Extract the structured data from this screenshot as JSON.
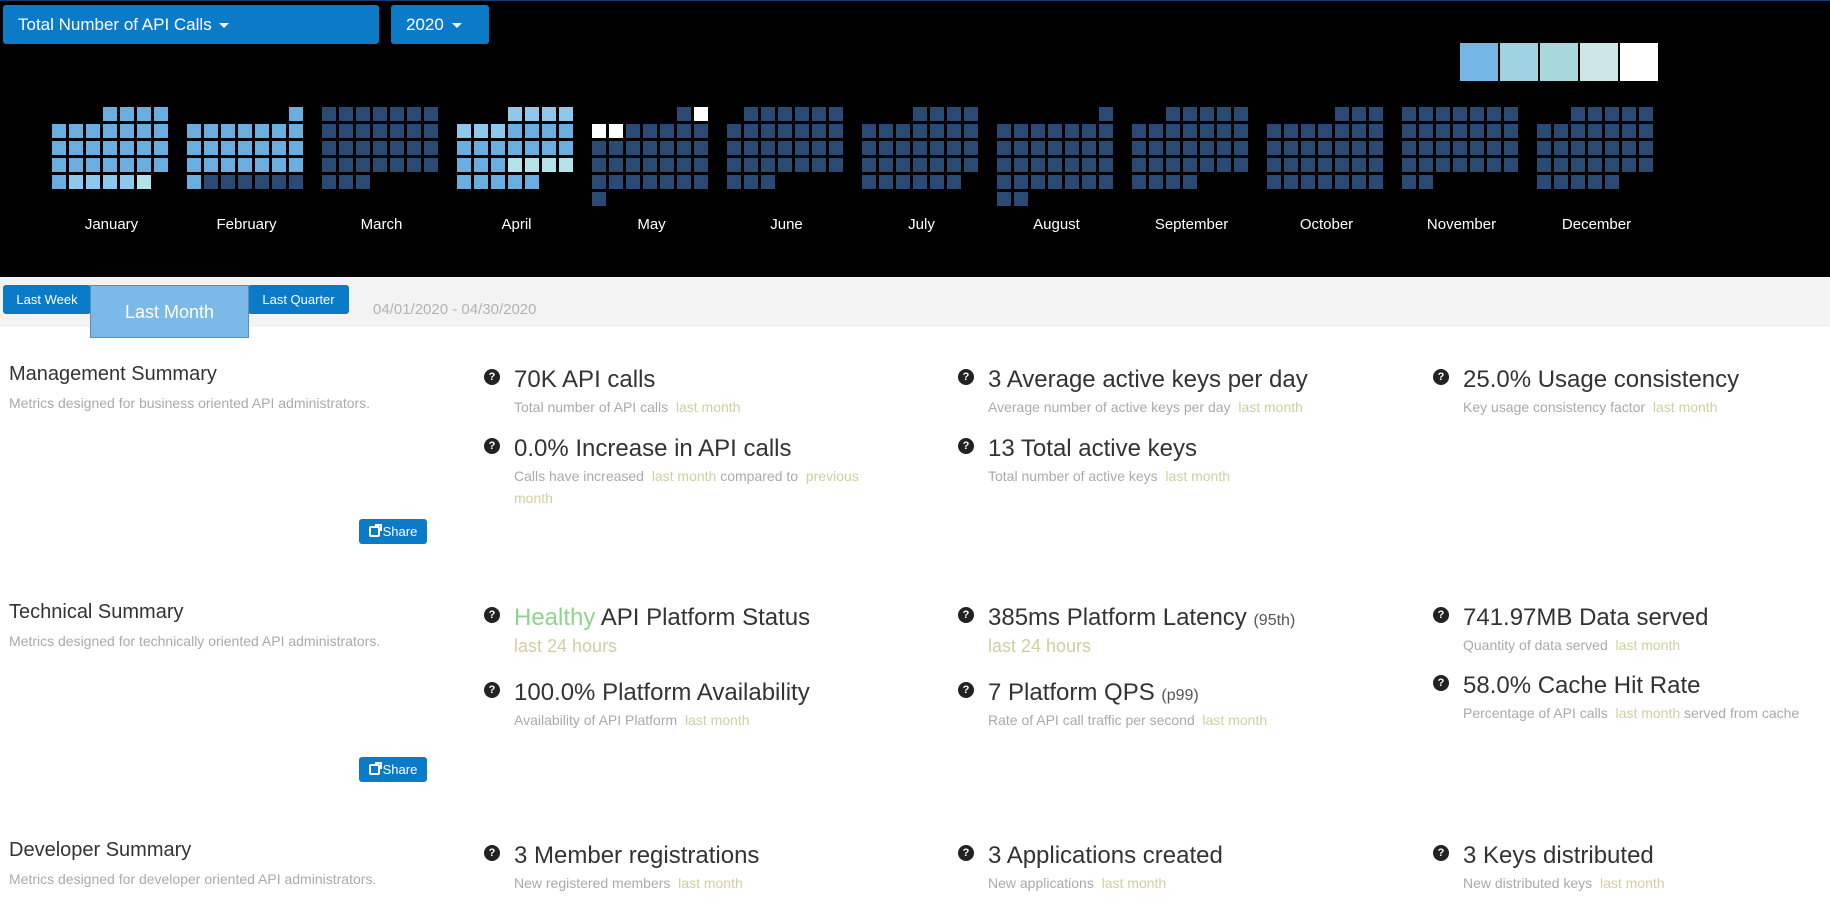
{
  "header": {
    "metric_dropdown": "Total Number of API Calls",
    "year_dropdown": "2020",
    "legend_colors": [
      "#74b6e6",
      "#9fd3e3",
      "#a8d8db",
      "#cbe8e6",
      "#ffffff"
    ]
  },
  "heatmap": {
    "year": 2020,
    "months": [
      "January",
      "February",
      "March",
      "April",
      "May",
      "June",
      "July",
      "August",
      "September",
      "October",
      "November",
      "December"
    ],
    "colors": {
      "empty": "#2b4a73",
      "low": "#6aaee0",
      "mid": "#8ec8ec",
      "high": "#b3e2e8",
      "max": "#ffffff"
    },
    "levels": {
      "1": "low",
      "2": "low",
      "3": "low",
      "4": "low",
      "5": "low",
      "6": "low",
      "7": "low",
      "8": "low",
      "9": "low",
      "10": "low",
      "11": "low",
      "12": "low",
      "13": "low",
      "14": "low",
      "15": "low",
      "16": "low",
      "17": "low",
      "18": "low",
      "19": "low",
      "20": "low",
      "21": "low",
      "22": "low",
      "23": "low",
      "24": "low",
      "25": "low",
      "26": "low",
      "27": "mid",
      "28": "mid",
      "29": "mid",
      "30": "mid",
      "31": "high",
      "32": "low",
      "33": "low",
      "34": "low",
      "35": "low",
      "36": "low",
      "37": "low",
      "38": "low",
      "39": "low",
      "40": "low",
      "41": "low",
      "42": "low",
      "43": "low",
      "44": "low",
      "45": "low",
      "46": "low",
      "47": "low",
      "48": "low",
      "49": "low",
      "50": "low",
      "51": "low",
      "52": "low",
      "53": "low",
      "54": "low",
      "92": "mid",
      "93": "mid",
      "94": "mid",
      "95": "mid",
      "96": "mid",
      "97": "mid",
      "98": "mid",
      "99": "low",
      "100": "low",
      "101": "low",
      "102": "low",
      "103": "low",
      "104": "low",
      "105": "low",
      "106": "low",
      "107": "low",
      "108": "low",
      "109": "low",
      "110": "low",
      "111": "low",
      "112": "low",
      "113": "high",
      "114": "high",
      "115": "high",
      "116": "high",
      "117": "low",
      "118": "low",
      "119": "low",
      "120": "low",
      "121": "low",
      "123": "max",
      "124": "max",
      "125": "max"
    }
  },
  "range": {
    "last_week": "Last Week",
    "last_month": "Last Month",
    "last_quarter": "Last Quarter",
    "dates": "04/01/2020 - 04/30/2020"
  },
  "management": {
    "title": "Management Summary",
    "desc": "Metrics designed for business oriented API administrators.",
    "share": "Share",
    "api_calls": {
      "value": "70K API calls",
      "desc": "Total number of API calls",
      "period": "last month"
    },
    "increase": {
      "value": "0.0% Increase in API calls",
      "desc_a": "Calls have increased",
      "period": "last month",
      "desc_b": "compared to",
      "period2_a": "previous",
      "period2_b": "month"
    },
    "avg_keys": {
      "value": "3 Average active keys per day",
      "desc": "Average number of active keys per day",
      "period": "last month"
    },
    "total_keys": {
      "value": "13 Total active keys",
      "desc": "Total number of active keys",
      "period": "last month"
    },
    "consistency": {
      "value": "25.0% Usage consistency",
      "desc": "Key usage consistency factor",
      "period": "last month"
    }
  },
  "technical": {
    "title": "Technical Summary",
    "desc": "Metrics designed for technically oriented API administrators.",
    "share": "Share",
    "status": {
      "state": "Healthy",
      "label": "API Platform Status",
      "period": "last 24 hours"
    },
    "latency": {
      "value": "385ms Platform Latency",
      "qualifier": "(95th)",
      "period": "last 24 hours"
    },
    "data_served": {
      "value": "741.97MB Data served",
      "desc": "Quantity of data served",
      "period": "last month"
    },
    "availability": {
      "value": "100.0% Platform Availability",
      "desc": "Availability of API Platform",
      "period": "last month"
    },
    "qps": {
      "value": "7 Platform QPS",
      "qualifier": "(p99)",
      "desc": "Rate of API call traffic per second",
      "period": "last month"
    },
    "cache": {
      "value": "58.0% Cache Hit Rate",
      "desc_a": "Percentage of API calls",
      "period": "last month",
      "desc_b": "served from cache"
    }
  },
  "developer": {
    "title": "Developer Summary",
    "desc": "Metrics designed for developer oriented API administrators.",
    "members": {
      "value": "3 Member registrations",
      "desc": "New registered members",
      "period": "last month"
    },
    "apps": {
      "value": "3 Applications created",
      "desc": "New applications",
      "period": "last month"
    },
    "keys": {
      "value": "3 Keys distributed",
      "desc": "New distributed keys",
      "period": "last month"
    }
  }
}
